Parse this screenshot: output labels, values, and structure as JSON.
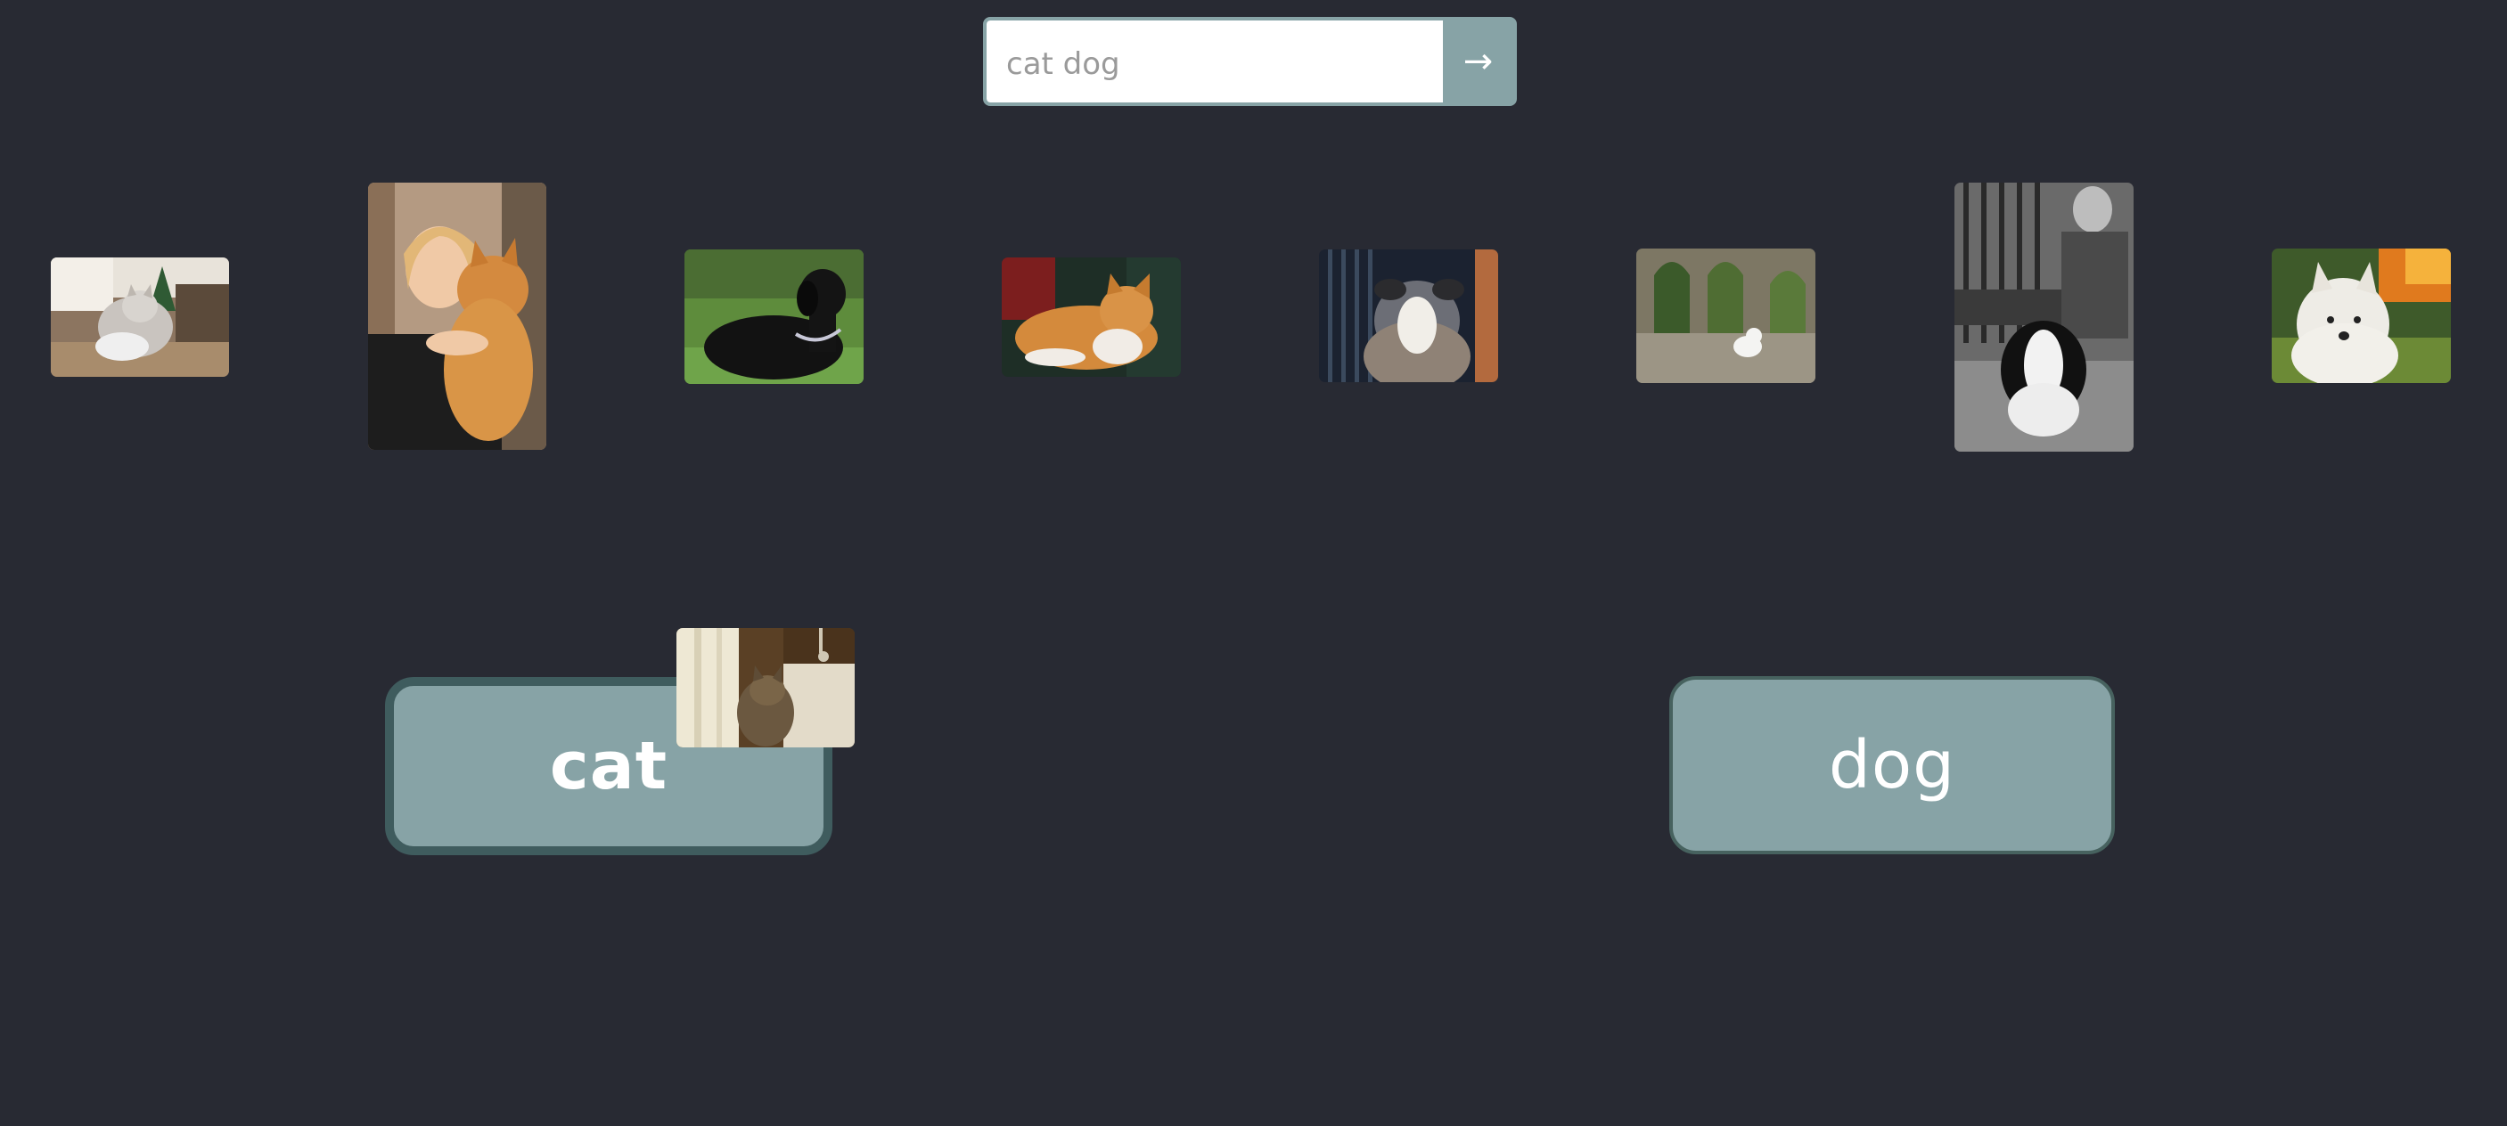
{
  "search": {
    "placeholder": "cat dog",
    "submit_label": "→"
  },
  "categories": [
    {
      "label": "cat",
      "active": true
    },
    {
      "label": "dog",
      "active": false
    }
  ],
  "colors": {
    "background": "#282a33",
    "accent": "#87a3a6",
    "active_border": "#3f5c5e"
  }
}
